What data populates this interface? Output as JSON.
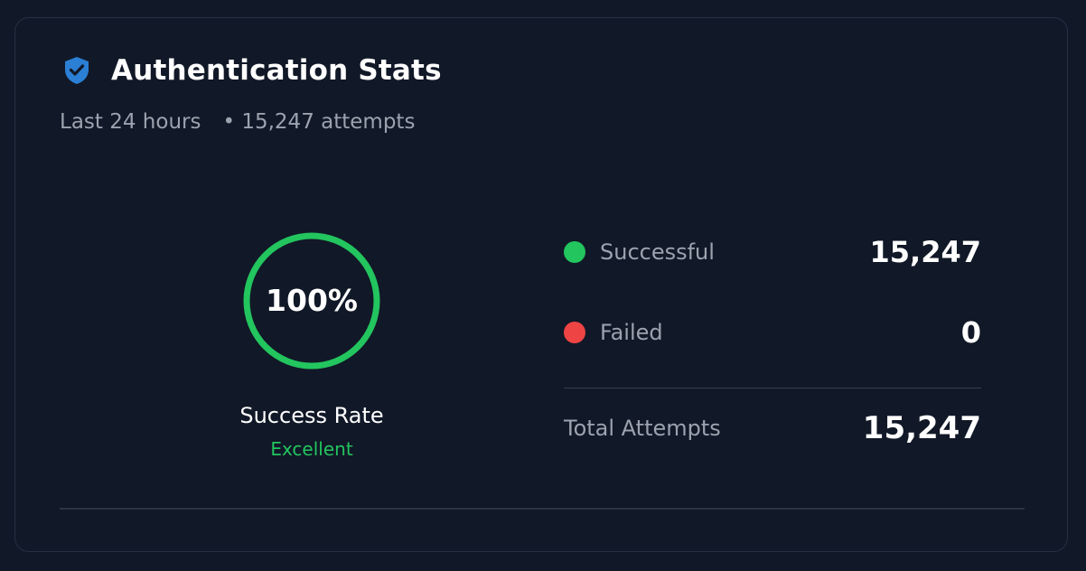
{
  "header": {
    "title": "Authentication Stats",
    "icon": "shield-check-icon",
    "icon_color": "#2b7fd4"
  },
  "subtitle": {
    "period": "Last 24 hours",
    "attempts": "• 15,247 attempts"
  },
  "gauge": {
    "value_label": "100%",
    "fraction": 1.0,
    "color": "#22c55e",
    "label": "Success Rate",
    "status": "Excellent"
  },
  "stats": {
    "successful": {
      "label": "Successful",
      "value": "15,247",
      "color": "#22c55e"
    },
    "failed": {
      "label": "Failed",
      "value": "0",
      "color": "#ef4444"
    },
    "total": {
      "label": "Total Attempts",
      "value": "15,247"
    }
  }
}
